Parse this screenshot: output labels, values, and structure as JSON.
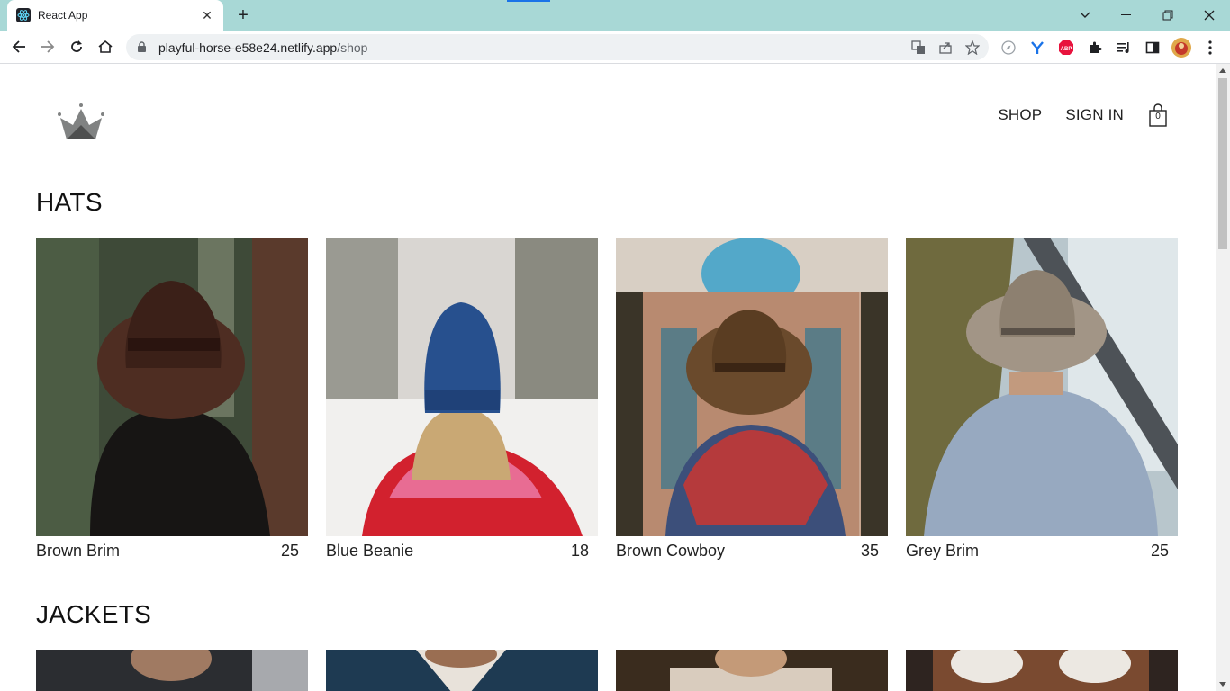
{
  "browser": {
    "tab_title": "React App",
    "url_host": "playful-horse-e58e24.netlify.app",
    "url_path": "/shop",
    "accent": "#a8d8d6"
  },
  "nav": {
    "shop": "SHOP",
    "sign_in": "SIGN IN",
    "cart_count": "0"
  },
  "sections": {
    "hats": {
      "title": "HATS",
      "items": [
        {
          "name": "Brown Brim",
          "price": "25"
        },
        {
          "name": "Blue Beanie",
          "price": "18"
        },
        {
          "name": "Brown Cowboy",
          "price": "35"
        },
        {
          "name": "Grey Brim",
          "price": "25"
        }
      ]
    },
    "jackets": {
      "title": "JACKETS"
    }
  }
}
